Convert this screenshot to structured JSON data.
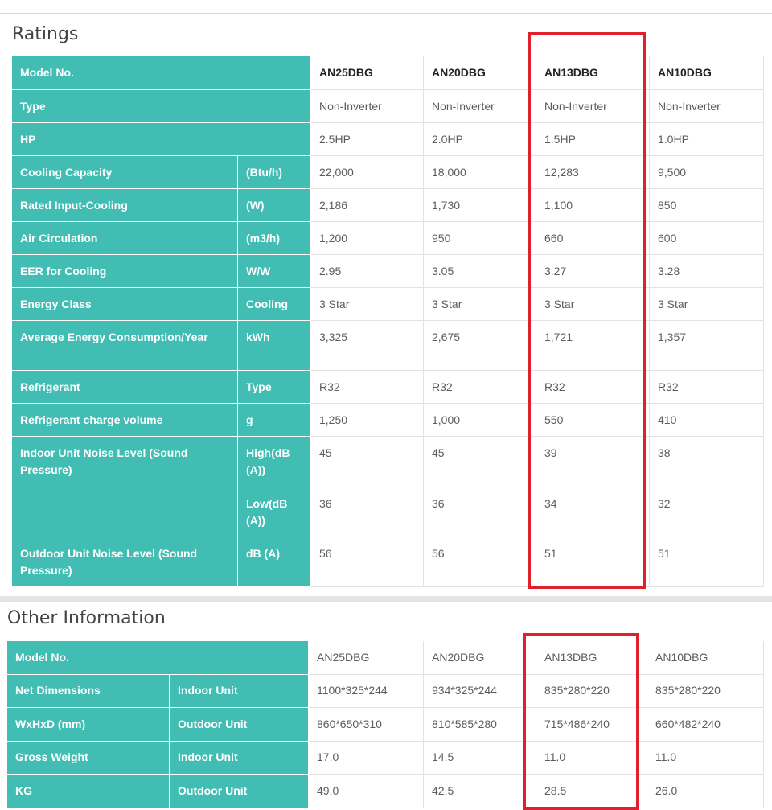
{
  "ratings": {
    "title": "Ratings",
    "models": [
      "AN25DBG",
      "AN20DBG",
      "AN13DBG",
      "AN10DBG"
    ],
    "header_label": "Model No.",
    "rows": [
      {
        "label": "Type",
        "unit": "",
        "values": [
          "Non-Inverter",
          "Non-Inverter",
          "Non-Inverter",
          "Non-Inverter"
        ]
      },
      {
        "label": "HP",
        "unit": "",
        "values": [
          "2.5HP",
          "2.0HP",
          "1.5HP",
          "1.0HP"
        ]
      },
      {
        "label": "Cooling Capacity",
        "unit": "(Btu/h)",
        "values": [
          "22,000",
          "18,000",
          "12,283",
          "9,500"
        ]
      },
      {
        "label": "Rated Input-Cooling",
        "unit": "(W)",
        "values": [
          "2,186",
          "1,730",
          "1,100",
          "850"
        ]
      },
      {
        "label": "Air Circulation",
        "unit": "(m3/h)",
        "values": [
          "1,200",
          "950",
          "660",
          "600"
        ]
      },
      {
        "label": "EER for Cooling",
        "unit": "W/W",
        "values": [
          "2.95",
          "3.05",
          "3.27",
          "3.28"
        ]
      },
      {
        "label": "Energy Class",
        "unit": "Cooling",
        "values": [
          "3 Star",
          "3 Star",
          "3 Star",
          "3 Star"
        ]
      },
      {
        "label": "Average Energy Consumption/Year",
        "unit": "kWh",
        "values": [
          "3,325",
          "2,675",
          "1,721",
          "1,357"
        ]
      },
      {
        "label": "Refrigerant",
        "unit": "Type",
        "values": [
          "R32",
          "R32",
          "R32",
          "R32"
        ]
      },
      {
        "label": "Refrigerant charge volume",
        "unit": "g",
        "values": [
          "1,250",
          "1,000",
          "550",
          "410"
        ]
      },
      {
        "label": "Indoor Unit Noise Level (Sound Pressure)",
        "unit": "High(dB (A))",
        "values": [
          "45",
          "45",
          "39",
          "38"
        ]
      },
      {
        "label": "",
        "unit": "Low(dB (A))",
        "values": [
          "36",
          "36",
          "34",
          "32"
        ]
      },
      {
        "label": "Outdoor Unit Noise Level (Sound Pressure)",
        "unit": "dB (A)",
        "values": [
          "56",
          "56",
          "51",
          "51"
        ]
      }
    ]
  },
  "other": {
    "title": "Other Information",
    "header_label": "Model No.",
    "models": [
      "AN25DBG",
      "AN20DBG",
      "AN13DBG",
      "AN10DBG"
    ],
    "rows": [
      {
        "label": "Net Dimensions",
        "sub": "Indoor Unit",
        "values": [
          "1100*325*244",
          "934*325*244",
          "835*280*220",
          "835*280*220"
        ]
      },
      {
        "label": "WxHxD (mm)",
        "sub": "Outdoor Unit",
        "values": [
          "860*650*310",
          "810*585*280",
          "715*486*240",
          "660*482*240"
        ]
      },
      {
        "label": "Gross Weight",
        "sub": "Indoor Unit",
        "values": [
          "17.0",
          "14.5",
          "11.0",
          "11.0"
        ]
      },
      {
        "label": "KG",
        "sub": "Outdoor Unit",
        "values": [
          "49.0",
          "42.5",
          "28.5",
          "26.0"
        ]
      }
    ]
  },
  "colors": {
    "header": "#41bdb3",
    "highlight": "#e0202a"
  }
}
